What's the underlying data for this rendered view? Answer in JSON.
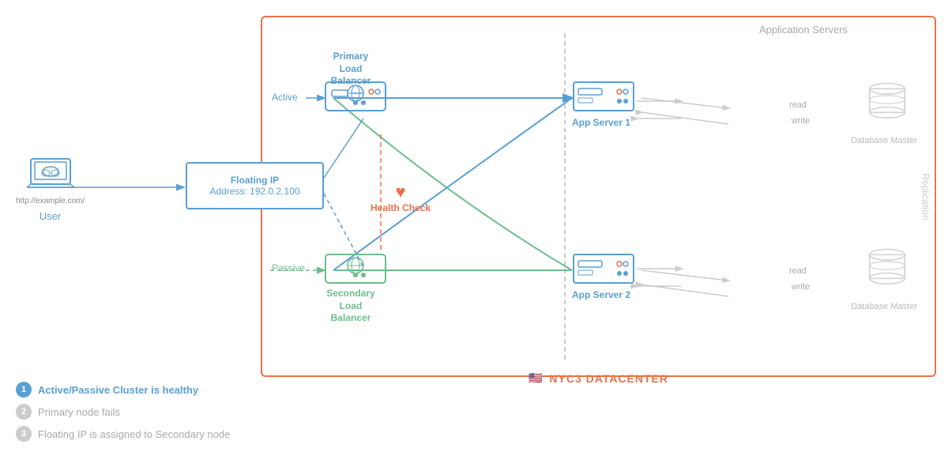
{
  "datacenter": {
    "label": "NYC3 DATACENTER",
    "app_servers_heading": "Application Servers",
    "replication": "Replication"
  },
  "user": {
    "label": "User",
    "url": "http://example.com/"
  },
  "floating_ip": {
    "title": "Floating IP",
    "address_label": "Address: 192.0.2.100"
  },
  "load_balancers": {
    "primary_label": "Primary\nLoad Balancer",
    "secondary_label": "Secondary\nLoad Balancer",
    "active_label": "Active",
    "passive_label": "Passive"
  },
  "app_servers": {
    "server1_label": "App Server 1",
    "server2_label": "App Server 2"
  },
  "database": {
    "master1_label": "Database Master",
    "master2_label": "Database Master",
    "read": "read",
    "write": "write"
  },
  "health_check": {
    "label": "Health Check"
  },
  "legend": {
    "item1": "Active/Passive Cluster is healthy",
    "item2": "Primary node fails",
    "item3": "Floating IP is assigned to Secondary node",
    "num1": "1",
    "num2": "2",
    "num3": "3"
  }
}
